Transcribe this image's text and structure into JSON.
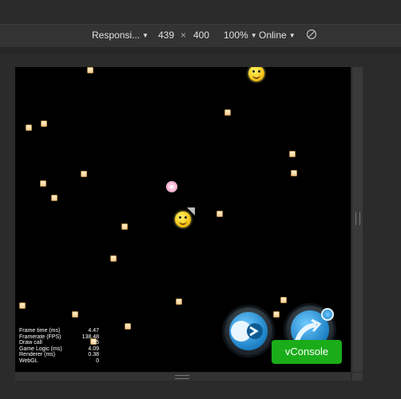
{
  "toolbar": {
    "device": "Responsi...",
    "width": "439",
    "times": "×",
    "height": "400",
    "zoom": "100%",
    "network": "Online"
  },
  "stats": [
    {
      "label": "Frame time (ms)",
      "value": "4.47"
    },
    {
      "label": "Framerate (FPS)",
      "value": "138.48"
    },
    {
      "label": "Draw call",
      "value": "15"
    },
    {
      "label": "Game Logic (ms)",
      "value": "4.09"
    },
    {
      "label": "Renderer (ms)",
      "value": "0.38"
    },
    {
      "label": "WebGL",
      "value": "0"
    }
  ],
  "vconsole_label": "vConsole"
}
